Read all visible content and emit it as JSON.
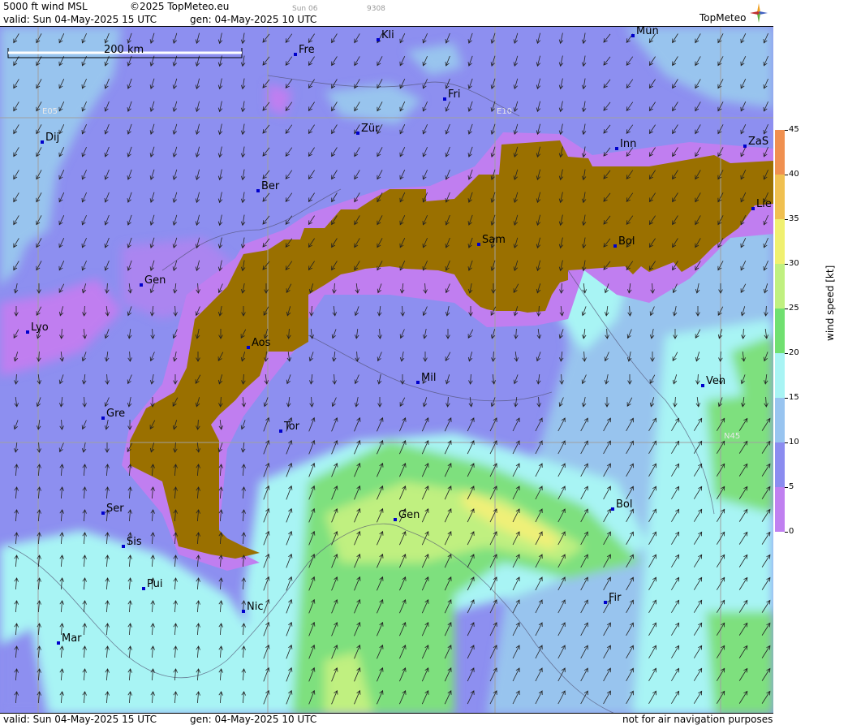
{
  "header": {
    "product": "5000 ft wind MSL",
    "copyright": "©2025 TopMeteo.eu",
    "faint_day": "Sun 06",
    "faint_code": "9308",
    "valid": "valid:  Sun  04-May-2025  15 UTC",
    "gen": "gen: 04-May-2025 10 UTC",
    "logo": "TopMeteo"
  },
  "footer": {
    "valid": "valid:  Sun  04-May-2025  15 UTC",
    "gen": "gen: 04-May-2025 10 UTC",
    "disclaimer": "not for air navigation purposes"
  },
  "map": {
    "scale_label": "200 km",
    "grid_labels": [
      "E05",
      "E10",
      "N45"
    ],
    "cities": [
      "Kli",
      "Mün",
      "Fre",
      "Fri",
      "Dij",
      "Zür",
      "Inn",
      "ZaS",
      "Ber",
      "Lie",
      "Sam",
      "Bol",
      "Gen",
      "Lyo",
      "Aos",
      "Mil",
      "Ven",
      "Gre",
      "Tor",
      "Ser",
      "Gen",
      "Bol",
      "Sis",
      "Pui",
      "Nic",
      "Fir",
      "Mar"
    ]
  },
  "colors": {
    "terrain": "#9a7000",
    "purple": "#8d8ff0",
    "violet": "#c07ef0",
    "lightblue": "#98c4ee",
    "cyan": "#a8f4f4",
    "green": "#7ee07e",
    "lightgreen": "#c0f080",
    "yellow": "#f0f078"
  },
  "colorbar": {
    "label": "wind speed [kt]",
    "ticks": [
      "0",
      "5",
      "10",
      "15",
      "20",
      "25",
      "30",
      "35",
      "40",
      "45"
    ],
    "colors": [
      "#c080f0",
      "#8b8cf0",
      "#98c4f0",
      "#a8f4f4",
      "#70e070",
      "#c0f080",
      "#f0f070",
      "#f0c050",
      "#f09050",
      "#e86050"
    ]
  }
}
